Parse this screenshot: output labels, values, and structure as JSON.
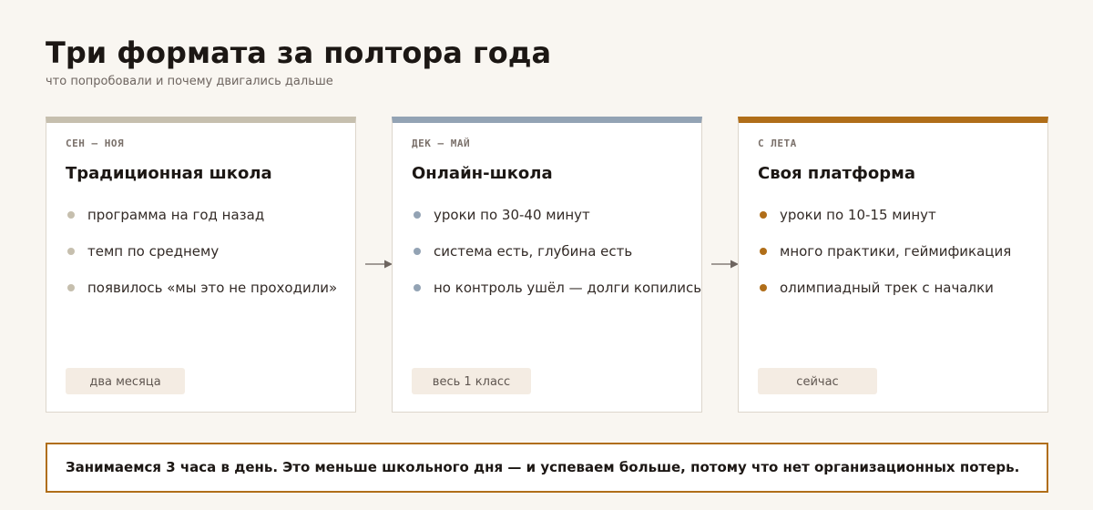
{
  "header": {
    "title": "Три формата за полтора года",
    "subtitle": "что попробовали и почему двигались дальше"
  },
  "colors": {
    "background": "#f9f6f1",
    "stage1_accent": "#c6bfae",
    "stage2_accent": "#93a3b4",
    "stage3_accent": "#b06e19",
    "badge_background": "#f4ece3",
    "arrow": "#6e6560"
  },
  "stages": [
    {
      "period": "СЕН — НОЯ",
      "title": "Традиционная школа",
      "points": [
        "программа на год назад",
        "темп по среднему",
        "появилось «мы это не проходили»"
      ],
      "duration": "два месяца"
    },
    {
      "period": "ДЕК — МАЙ",
      "title": "Онлайн-школа",
      "points": [
        "уроки по 30-40 минут",
        "система есть, глубина есть",
        "но контроль ушёл — долги копились"
      ],
      "duration": "весь 1 класс"
    },
    {
      "period": "С ЛЕТА",
      "title": "Своя платформа",
      "points": [
        "уроки по 10-15 минут",
        "много практики, геймификация",
        "олимпиадный трек с началки"
      ],
      "duration": "сейчас"
    }
  ],
  "connectors": [
    "arrow-right-icon",
    "arrow-right-icon"
  ],
  "callout": {
    "text": "Занимаемся 3 часа в день. Это меньше школьного дня — и успеваем больше, потому что нет организационных потерь."
  }
}
